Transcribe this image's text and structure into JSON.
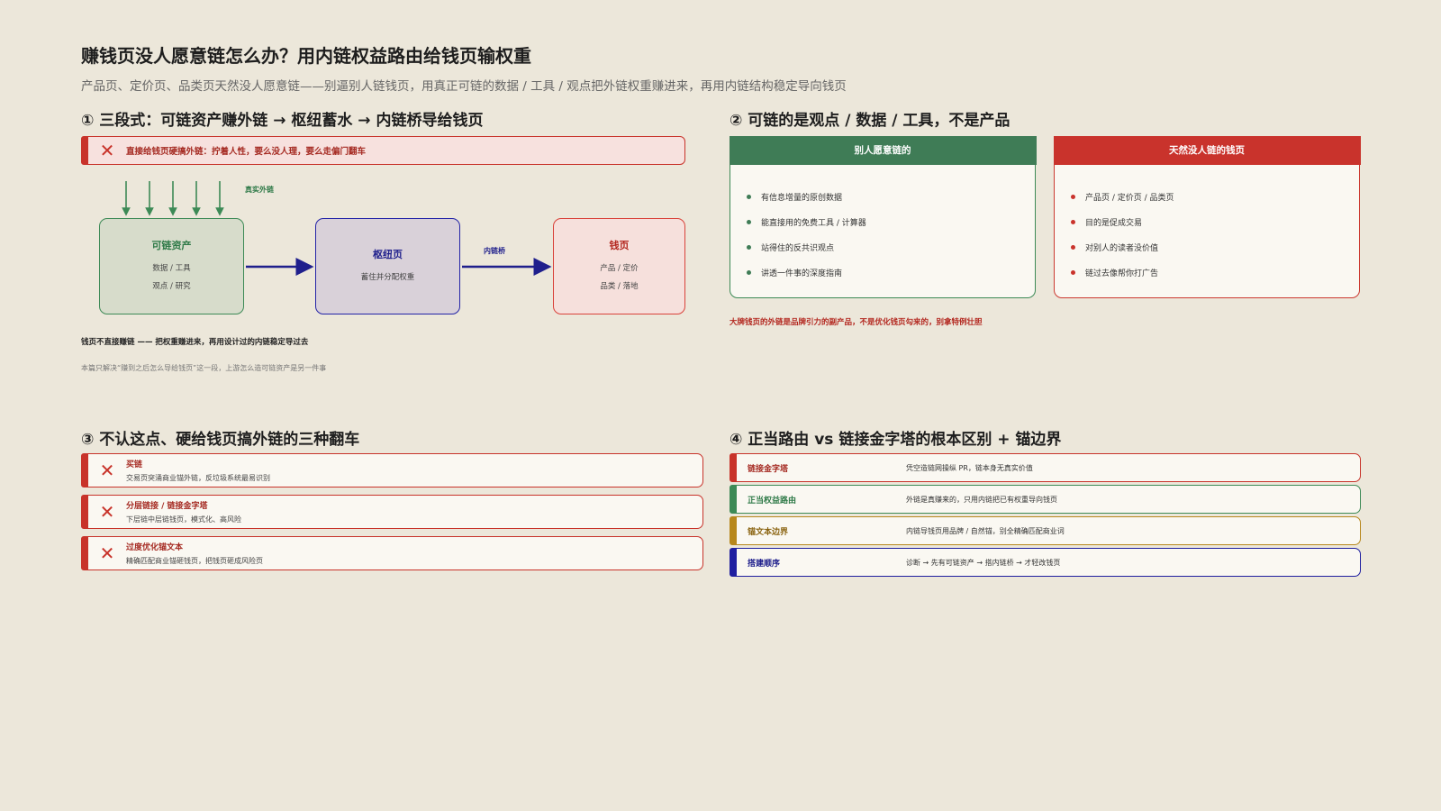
{
  "header": {
    "title": "赚钱页没人愿意链怎么办？用内链权益路由给钱页输权重",
    "subtitle": "产品页、定价页、品类页天然没人愿意链——别逼别人链钱页，用真正可链的数据 / 工具 / 观点把外链权重赚进来，再用内链结构稳定导向钱页"
  },
  "section1": {
    "title": "① 三段式：可链资产赚外链 → 枢纽蓄水 → 内链桥导给钱页",
    "warning": "直接给钱页硬搞外链：拧着人性，要么没人理，要么走偏门翻车",
    "diagram": {
      "external_label": "真实外链",
      "bridge_label": "内链桥",
      "asset": {
        "title": "可链资产",
        "lines": [
          "数据 / 工具",
          "观点 / 研究"
        ]
      },
      "hub": {
        "title": "枢纽页",
        "lines": [
          "蓄住并分配权重"
        ]
      },
      "money": {
        "title": "钱页",
        "lines": [
          "产品 / 定价",
          "品类 / 落地"
        ]
      }
    },
    "note_bold": "钱页不直接赚链 —— 把权重赚进来，再用设计过的内链稳定导过去",
    "note_muted": "本篇只解决“赚到之后怎么导给钱页”这一段，上游怎么造可链资产是另一件事"
  },
  "section2": {
    "title": "② 可链的是观点 / 数据 / 工具，不是产品",
    "willing": {
      "header": "别人愿意链的",
      "items": [
        "有信息增量的原创数据",
        "能直接用的免费工具 / 计算器",
        "站得住的反共识观点",
        "讲透一件事的深度指南"
      ]
    },
    "nolink": {
      "header": "天然没人链的钱页",
      "items": [
        "产品页 / 定价页 / 品类页",
        "目的是促成交易",
        "对别人的读者没价值",
        "链过去像帮你打广告"
      ]
    },
    "note": "大牌钱页的外链是品牌引力的副产品，不是优化钱页勾来的，别拿特例壮胆"
  },
  "section3": {
    "title": "③ 不认这点、硬给钱页搞外链的三种翻车",
    "items": [
      {
        "title": "买链",
        "desc": "交易页突涌商业锚外链，反垃圾系统最易识别"
      },
      {
        "title": "分层链接 / 链接金字塔",
        "desc": "下层链中层链钱页，模式化、高风险"
      },
      {
        "title": "过度优化锚文本",
        "desc": "精确匹配商业锚砸钱页，把钱页砸成风险页"
      }
    ]
  },
  "section4": {
    "title": "④ 正当路由 vs 链接金字塔的根本区别 + 锚边界",
    "rows": [
      {
        "key": "链接金字塔",
        "value": "凭空造链网操纵 PR，链本身无真实价值"
      },
      {
        "key": "正当权益路由",
        "value": "外链是真赚来的，只用内链把已有权重导向钱页"
      },
      {
        "key": "锚文本边界",
        "value": "内链导钱页用品牌 / 自然锚，别全精确匹配商业词"
      },
      {
        "key": "搭建顺序",
        "value": "诊断 → 先有可链资产 → 搭内链桥 → 才轻改钱页"
      }
    ]
  },
  "colors": {
    "background": "#ece7da",
    "green": "#3f7c56",
    "red": "#c9332c",
    "blue": "#1f1f8c",
    "amber": "#b7871c"
  }
}
